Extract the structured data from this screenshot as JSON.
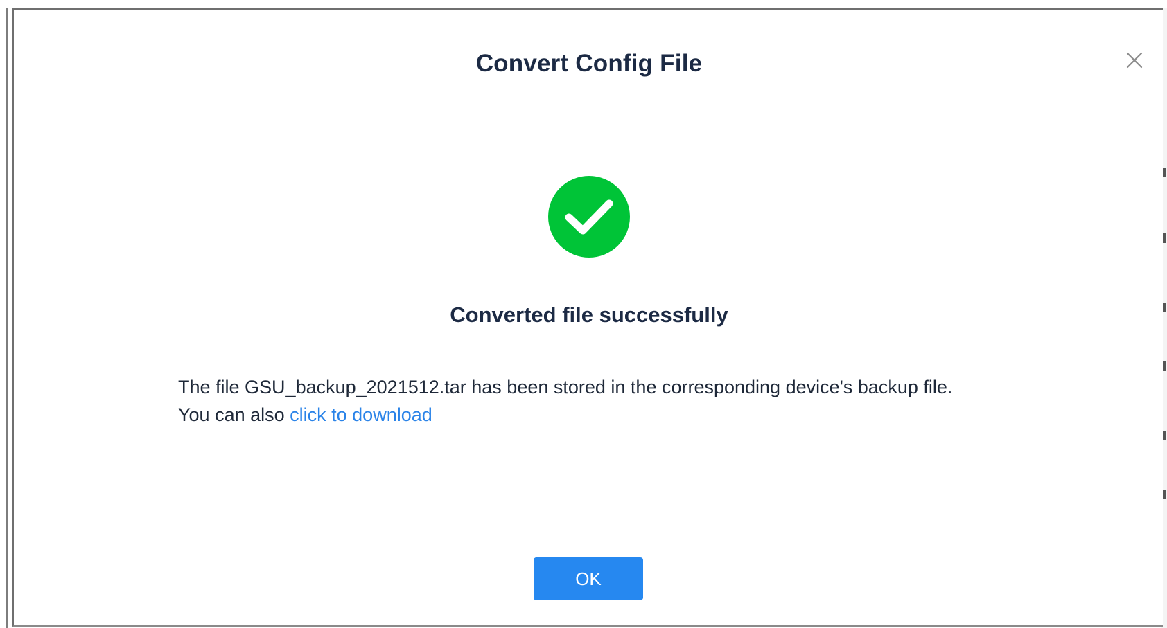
{
  "dialog": {
    "title": "Convert Config File",
    "close_icon": "close-icon",
    "status_icon": "success-check-icon",
    "accent_color": "#00c437",
    "heading": "Converted file successfully",
    "message": {
      "line1": "The file GSU_backup_2021512.tar has been stored in the corresponding device's backup file.",
      "line2_prefix": "You can also ",
      "download_link": "click to download"
    },
    "ok_label": "OK",
    "primary_color": "#2688f0",
    "link_color": "#2a83e8"
  }
}
